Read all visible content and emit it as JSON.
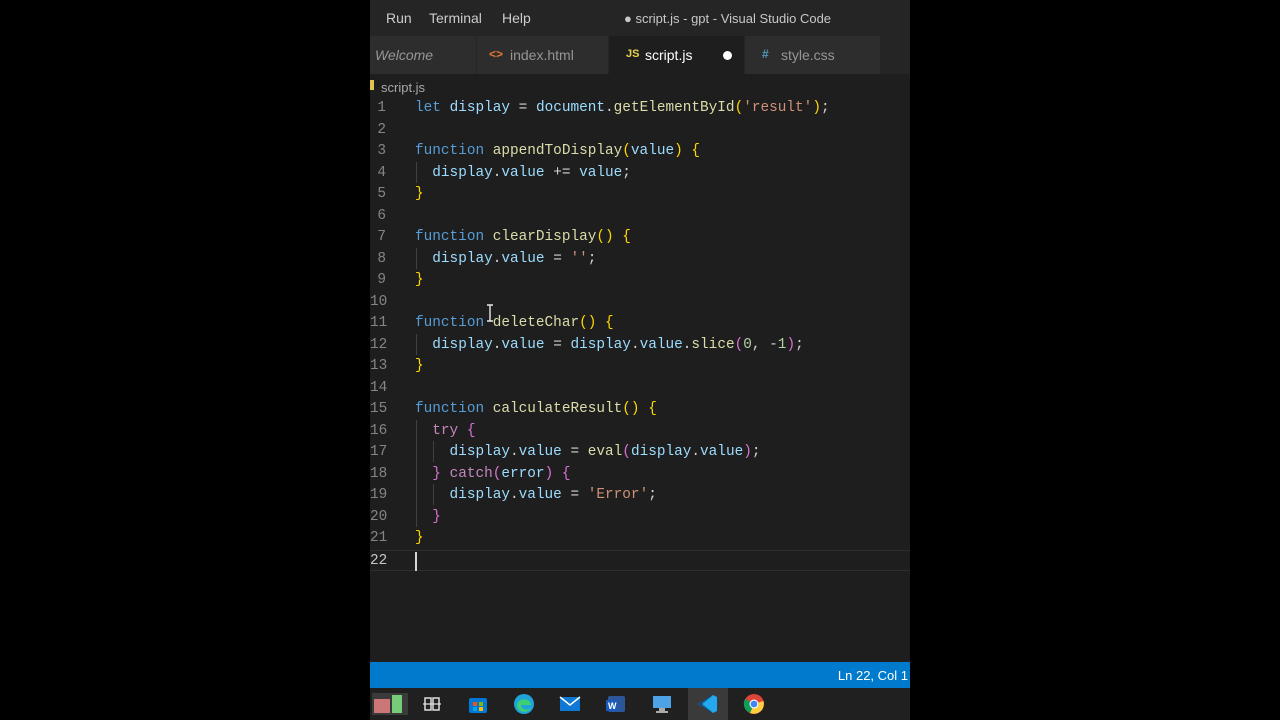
{
  "window": {
    "title": "● script.js - gpt - Visual Studio Code"
  },
  "menu": [
    "Run",
    "Terminal",
    "Help"
  ],
  "tabs": [
    {
      "label": "Welcome",
      "icon": "",
      "italic": true,
      "active": false
    },
    {
      "label": "index.html",
      "icon": "<>",
      "active": false
    },
    {
      "label": "script.js",
      "icon": "JS",
      "active": true,
      "modified": true
    },
    {
      "label": "style.css",
      "icon": "#",
      "active": false
    }
  ],
  "breadcrumb": "script.js",
  "editor": {
    "lines": [
      "let display = document.getElementById('result');",
      "",
      "function appendToDisplay(value) {",
      "  display.value += value;",
      "}",
      "",
      "function clearDisplay() {",
      "  display.value = '';",
      "}",
      "",
      "function deleteChar() {",
      "  display.value = display.value.slice(0, -1);",
      "}",
      "",
      "function calculateResult() {",
      "  try {",
      "    display.value = eval(display.value);",
      "  } catch(error) {",
      "    display.value = 'Error';",
      "  }",
      "}",
      ""
    ],
    "current_line": 22
  },
  "status": {
    "position": "Ln 22, Col 1"
  },
  "taskbar": {
    "icons": [
      "paint-icon",
      "task-view-icon",
      "store-icon",
      "edge-icon",
      "mail-icon",
      "word-icon",
      "remote-desktop-icon",
      "vscode-icon",
      "chrome-icon"
    ]
  },
  "colors": {
    "statusbar": "#007acc",
    "editor_bg": "#1e1e1e",
    "titlebar_bg": "#252526"
  }
}
